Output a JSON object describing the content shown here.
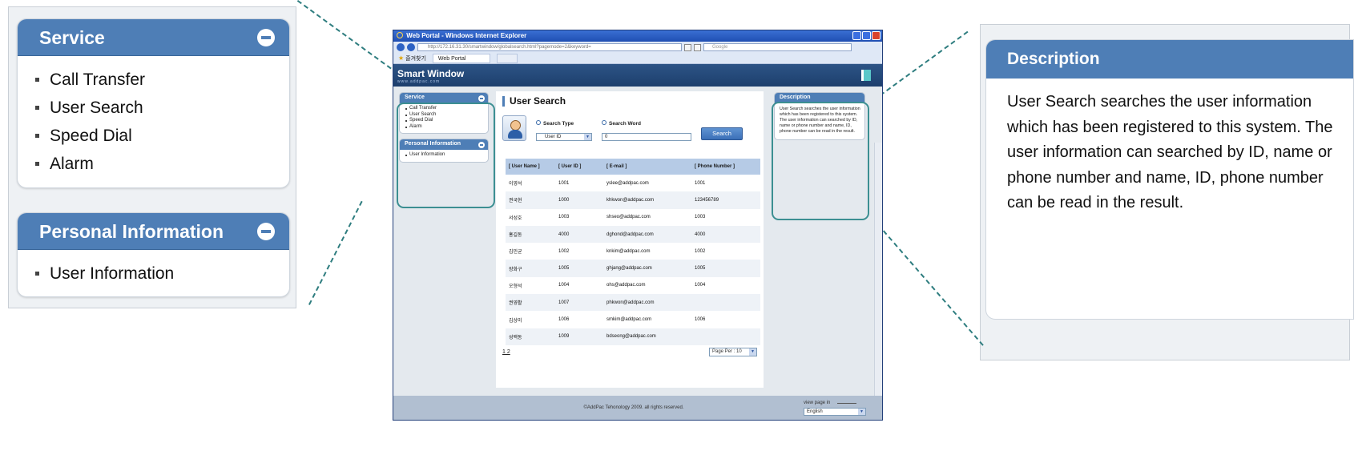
{
  "zoom_left": {
    "service": {
      "title": "Service",
      "items": [
        "Call Transfer",
        "User Search",
        "Speed Dial",
        "Alarm"
      ]
    },
    "personal": {
      "title": "Personal Information",
      "items": [
        "User Information"
      ]
    }
  },
  "zoom_right": {
    "title": "Description",
    "text": "User Search searches the user information which has been registered to this system. The user information can searched by ID, name or phone number and name, ID, phone number can be read in the result."
  },
  "browser": {
    "window_title": "Web Portal - Windows Internet Explorer",
    "address": "http://172.16.31.30/smartwindow/globalsearch.html?pagemode=2&keyword=",
    "search_placeholder": "Google",
    "favorites_label": "즐겨찾기",
    "tab_label": "Web Portal"
  },
  "app": {
    "title": "Smart Window",
    "subtitle": "www.addpac.com",
    "menu": {
      "service": {
        "title": "Service",
        "items": [
          "Call Transfer",
          "User Search",
          "Speed Dial",
          "Alarm"
        ]
      },
      "personal": {
        "title": "Personal Information",
        "items": [
          "User Information"
        ]
      }
    },
    "page_title": "User Search",
    "search_type_label": "Search Type",
    "search_word_label": "Search Word",
    "search_type_value": "User ID",
    "search_word_value": "0",
    "search_button": "Search",
    "table": {
      "headers": [
        "[ User Name ]",
        "[ User ID ]",
        "[ E-mail ]",
        "[ Phone Number ]"
      ],
      "rows": [
        [
          "이영석",
          "1001",
          "yslee@addpac.com",
          "1001"
        ],
        [
          "권국현",
          "1000",
          "khkwon@addpac.com",
          "123456789"
        ],
        [
          "서성호",
          "1003",
          "shseo@addpac.com",
          "1003"
        ],
        [
          "홍길동",
          "4000",
          "dghond@addpac.com",
          "4000"
        ],
        [
          "김민균",
          "1002",
          "knkim@addpac.com",
          "1002"
        ],
        [
          "장화구",
          "1005",
          "ghjang@addpac.com",
          "1005"
        ],
        [
          "오형석",
          "1004",
          "ohs@addpac.com",
          "1004"
        ],
        [
          "권영활",
          "1007",
          "phkwon@addpac.com",
          ""
        ],
        [
          "김상미",
          "1006",
          "smkim@addpac.com",
          "1006"
        ],
        [
          "성백동",
          "1009",
          "bdseong@addpac.com",
          ""
        ]
      ]
    },
    "pager": "1 2",
    "page_per": "Page Per : 10",
    "description_title": "Description",
    "description_text": "User Search searches the user information which has been registered to this system. The user information can searched by ID, name or phone number and name, ID, phone number can be read in the result.",
    "copyright": "©AddPac Tehonology 2009. all rights reserved.",
    "view_page_in": "view page in",
    "language": "English"
  },
  "colors": {
    "header_blue": "#4e7eb6",
    "app_bar": "#1d3f6d",
    "callout_teal": "#2e7d7f"
  }
}
